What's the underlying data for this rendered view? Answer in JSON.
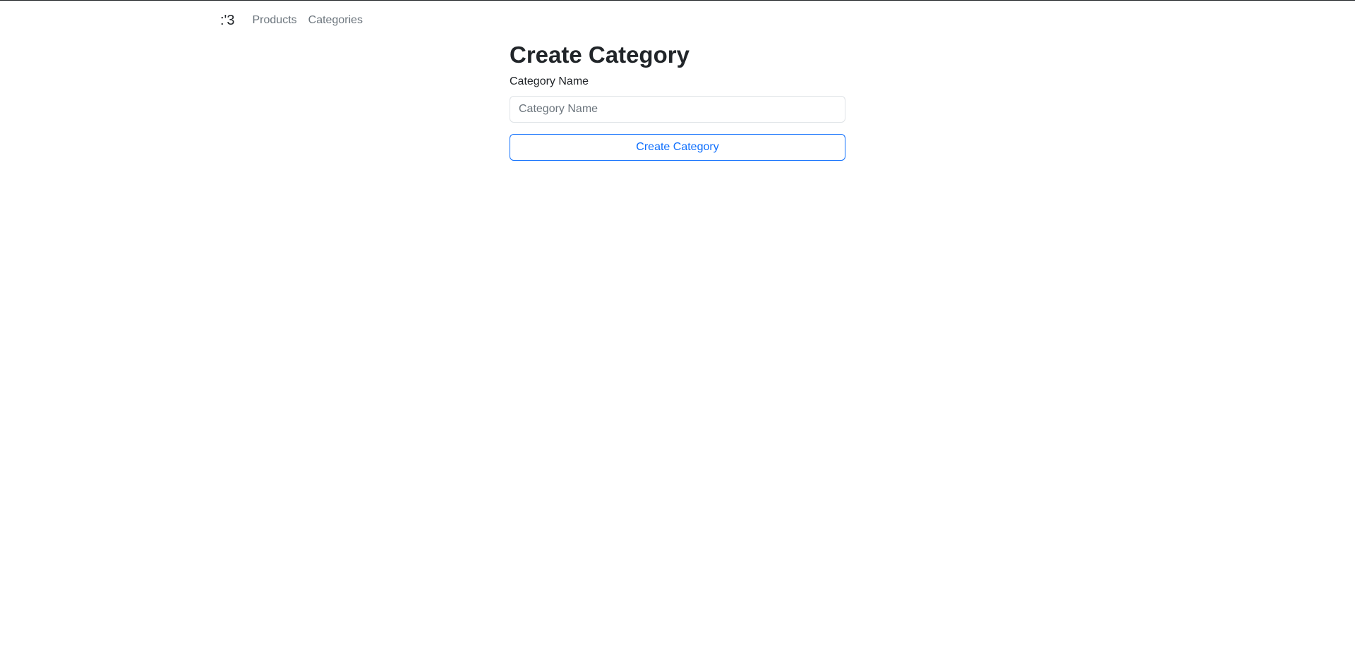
{
  "nav": {
    "brand": ":'3",
    "links": [
      {
        "label": "Products"
      },
      {
        "label": "Categories"
      }
    ]
  },
  "form": {
    "title": "Create Category",
    "name_label": "Category Name",
    "name_placeholder": "Category Name",
    "name_value": "",
    "submit_label": "Create Category"
  },
  "colors": {
    "primary": "#0d6efd",
    "text": "#212529",
    "muted": "#6c757d",
    "border": "#dee2e6"
  }
}
